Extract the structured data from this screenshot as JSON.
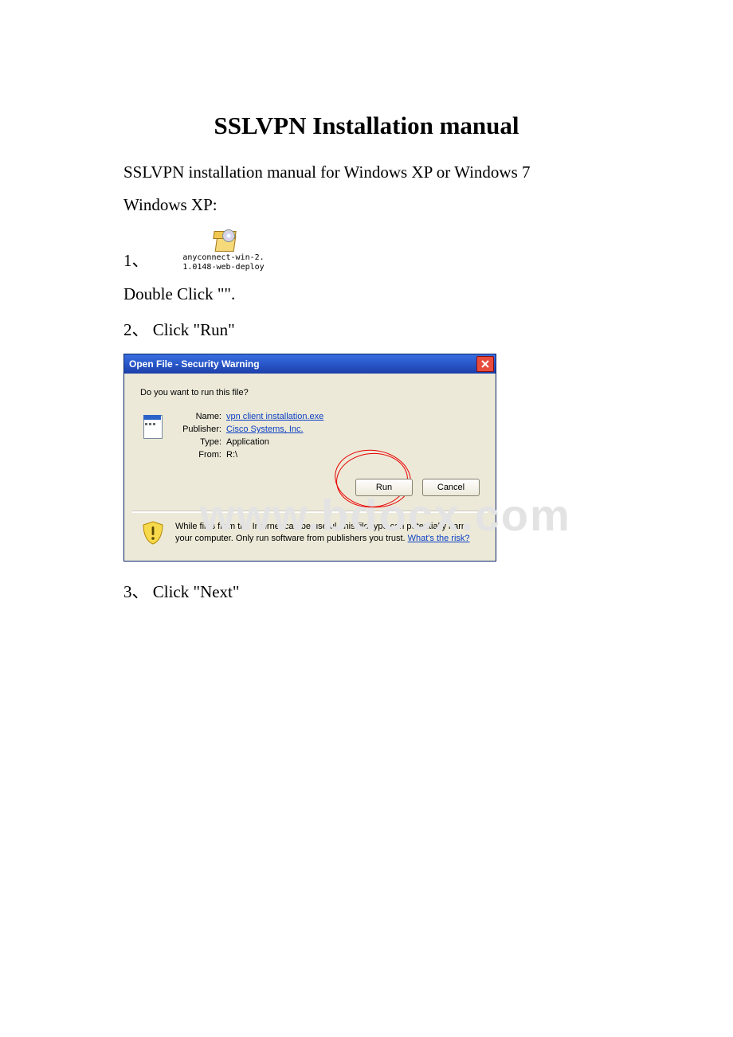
{
  "title": "SSLVPN Installation manual",
  "intro": "SSLVPN installation manual for Windows XP or Windows 7",
  "os_heading": "Windows XP:",
  "step1_marker": "1、",
  "file_icon_caption": "anyconnect-win-2.\n1.0148-web-deploy",
  "step1_text": "Double Click \"\".",
  "step2_marker": "2、",
  "step2_text": "Click \"Run\"",
  "dialog": {
    "title": "Open File - Security Warning",
    "lead": "Do you want to run this file?",
    "labels": {
      "name": "Name:",
      "publisher": "Publisher:",
      "type": "Type:",
      "from": "From:"
    },
    "values": {
      "name": "vpn client installation.exe",
      "publisher": "Cisco Systems, Inc.",
      "type": "Application",
      "from": "R:\\"
    },
    "buttons": {
      "run": "Run",
      "cancel": "Cancel"
    },
    "warning_text": "While files from the Internet can be useful, this file type can potentially harm your computer. Only run software from publishers you trust. ",
    "warning_link": "What's the risk?"
  },
  "step3_marker": "3、",
  "step3_text": "Click \"Next\"",
  "watermark": "www.bdocx.com"
}
